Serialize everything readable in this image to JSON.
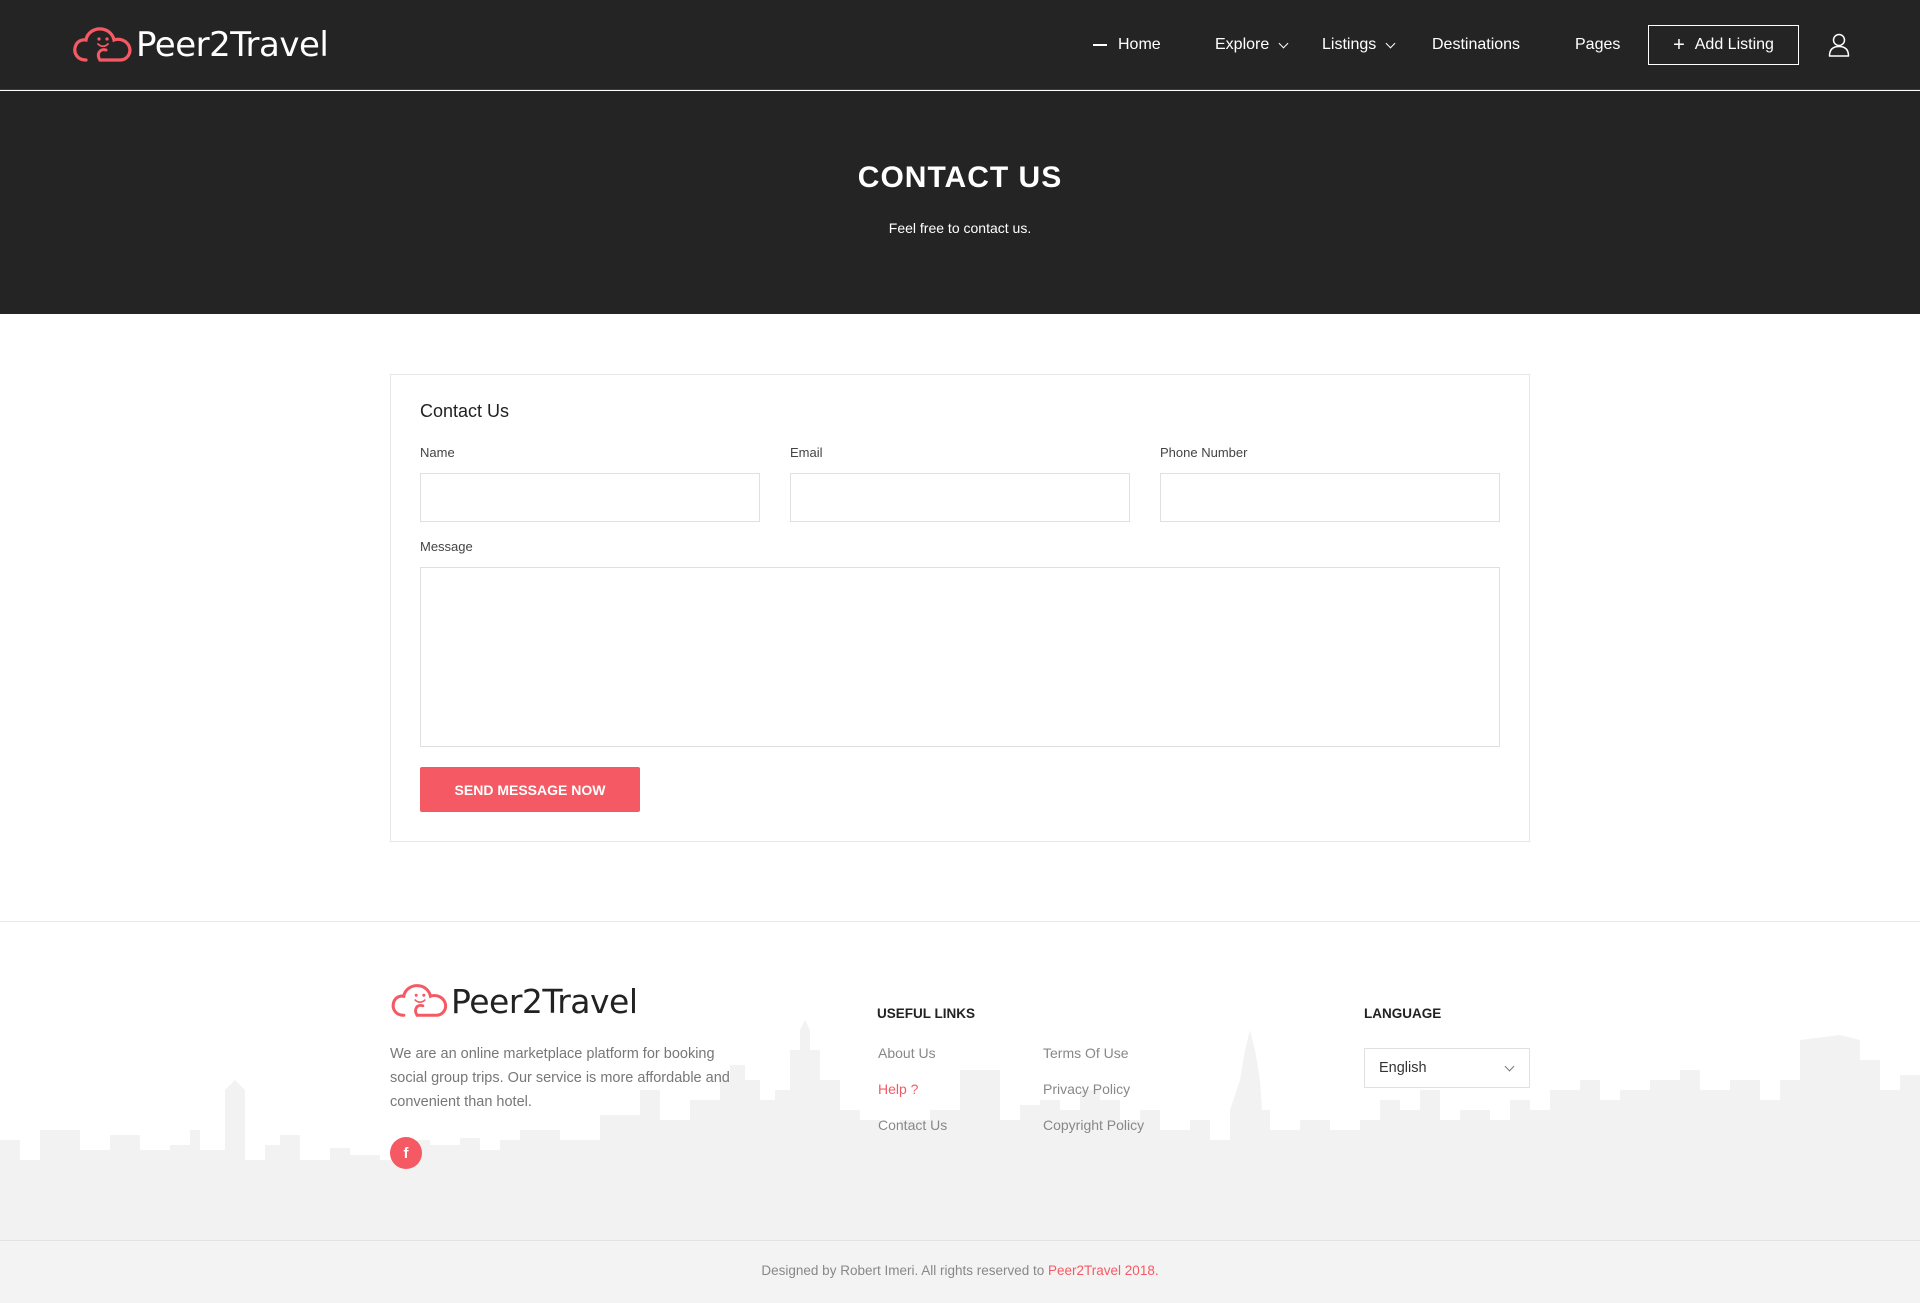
{
  "brand": {
    "name": "Peer2Travel",
    "accent": "#f55a64",
    "dark": "#242424"
  },
  "nav": {
    "items": [
      {
        "label": "Home",
        "active": true
      },
      {
        "label": "Explore",
        "has_dropdown": true
      },
      {
        "label": "Listings",
        "has_dropdown": true
      },
      {
        "label": "Destinations"
      },
      {
        "label": "Pages"
      }
    ],
    "add_listing": "Add Listing",
    "icons": {
      "add": "plus-icon",
      "user": "user-icon",
      "dropdown": "chevron-down-icon"
    }
  },
  "hero": {
    "title": "CONTACT US",
    "subtitle": "Feel free to contact us."
  },
  "contact_form": {
    "title": "Contact Us",
    "name_label": "Name",
    "name_value": "",
    "email_label": "Email",
    "email_value": "",
    "phone_label": "Phone Number",
    "phone_value": "",
    "message_label": "Message",
    "message_value": "",
    "submit_label": "SEND MESSAGE NOW"
  },
  "footer": {
    "description": "We are an online marketplace platform for booking social group trips. Our service is more affordable and convenient than hotel.",
    "social": {
      "facebook_glyph": "f",
      "icon": "facebook-icon"
    },
    "useful_links_heading": "USEFUL LINKS",
    "links": [
      {
        "label": "About Us"
      },
      {
        "label": "Terms Of Use"
      },
      {
        "label": "Help ?",
        "highlight": true
      },
      {
        "label": "Privacy Policy"
      },
      {
        "label": "Contact Us"
      },
      {
        "label": "Copyright Policy"
      }
    ],
    "language_heading": "LANGUAGE",
    "language_selected": "English",
    "copyright_prefix": "Designed by Robert Imeri. All rights reserved to ",
    "copyright_link": "Peer2Travel 2018."
  }
}
